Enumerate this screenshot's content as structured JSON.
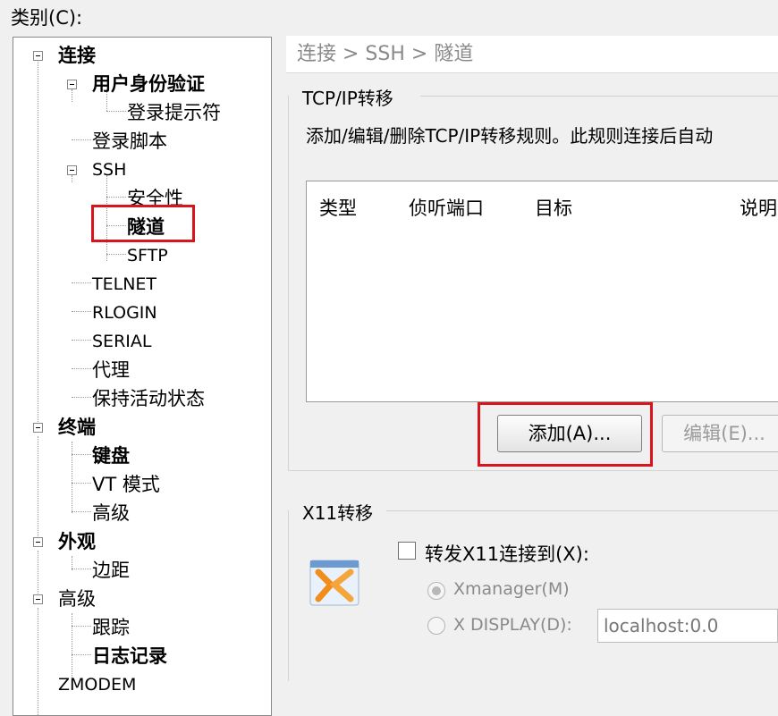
{
  "category_label": "类别(C):",
  "tree": {
    "nodes": [
      {
        "label": "连接"
      },
      {
        "label": "用户身份验证"
      },
      {
        "label": "登录提示符"
      },
      {
        "label": "登录脚本"
      },
      {
        "label": "SSH"
      },
      {
        "label": "安全性"
      },
      {
        "label": "隧道"
      },
      {
        "label": "SFTP"
      },
      {
        "label": "TELNET"
      },
      {
        "label": "RLOGIN"
      },
      {
        "label": "SERIAL"
      },
      {
        "label": "代理"
      },
      {
        "label": "保持活动状态"
      },
      {
        "label": "终端"
      },
      {
        "label": "键盘"
      },
      {
        "label": "VT 模式"
      },
      {
        "label": "高级"
      },
      {
        "label": "外观"
      },
      {
        "label": "边距"
      },
      {
        "label": "高级"
      },
      {
        "label": "跟踪"
      },
      {
        "label": "日志记录"
      },
      {
        "label": "ZMODEM"
      }
    ]
  },
  "breadcrumb": "连接 > SSH > 隧道",
  "tcp_forward": {
    "title": "TCP/IP转移",
    "description": "添加/编辑/删除TCP/IP转移规则。此规则连接后自动",
    "columns": [
      "类型",
      "侦听端口",
      "目标",
      "说明"
    ],
    "add_button": "添加(A)...",
    "edit_button": "编辑(E)..."
  },
  "x11_forward": {
    "title": "X11转移",
    "checkbox_label": "转发X11连接到(X):",
    "radio_xmanager": "Xmanager(M)",
    "radio_display": "X DISPLAY(D):",
    "display_value": "localhost:0.0"
  },
  "colors": {
    "highlight": "#d8141c"
  }
}
